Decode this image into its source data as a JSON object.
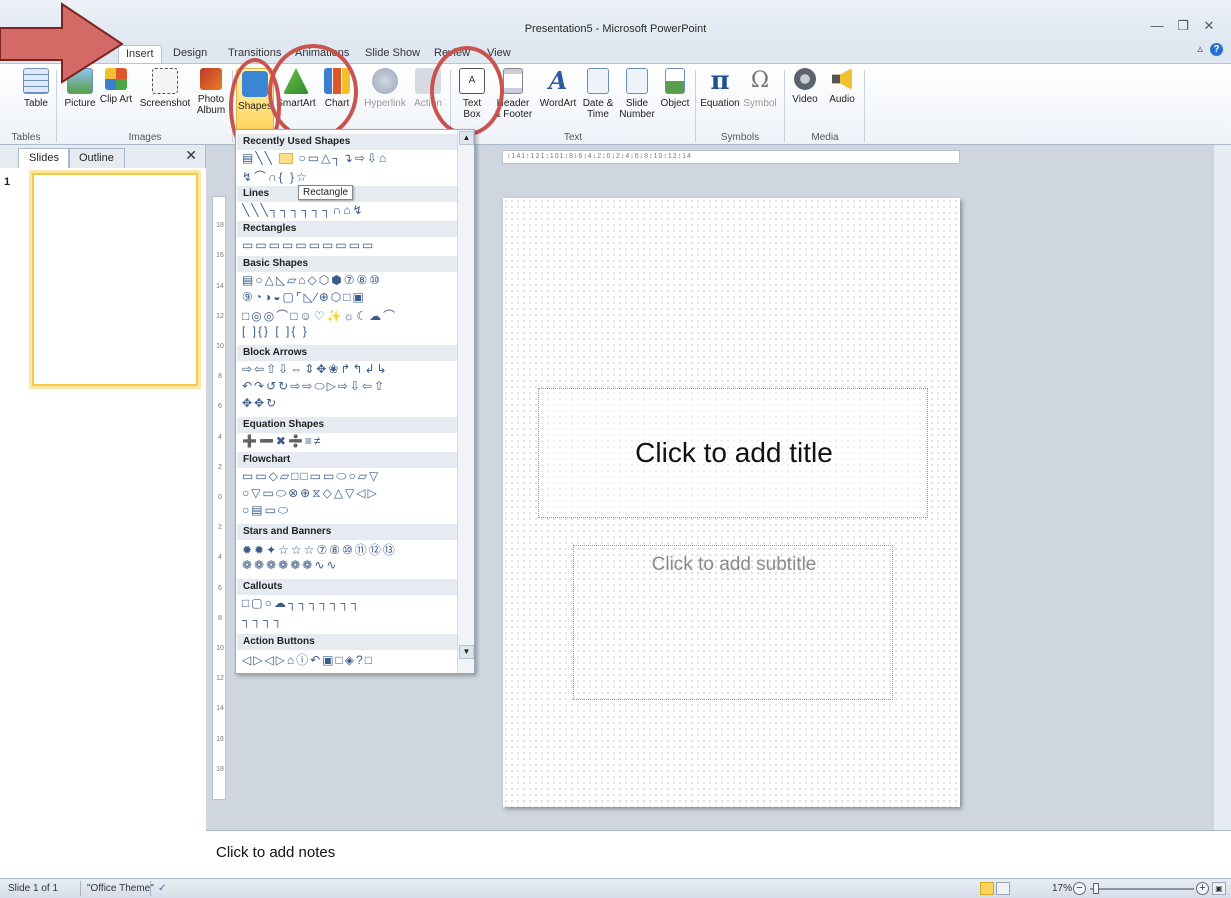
{
  "window": {
    "title": "Presentation5 - Microsoft PowerPoint",
    "qat_symbol": "↺ |▾",
    "minimize": "—",
    "restore": "❐",
    "close": "✕",
    "ribbon_collapse": "▵",
    "help": "?"
  },
  "tabs": [
    {
      "label": "Insert",
      "active": true
    },
    {
      "label": "Design"
    },
    {
      "label": "Transitions"
    },
    {
      "label": "Animations"
    },
    {
      "label": "Slide Show"
    },
    {
      "label": "Review"
    },
    {
      "label": "View"
    }
  ],
  "ribbon": {
    "buttons": {
      "table": "Table",
      "picture": "Picture",
      "clip_art": "Clip Art",
      "screenshot": "Screenshot",
      "photo_album": "Photo Album",
      "shapes": "Shapes",
      "smartart": "SmartArt",
      "chart": "Chart",
      "hyperlink": "Hyperlink",
      "action": "Action",
      "text_box": "Text Box",
      "header_footer": "Header & Footer",
      "wordart": "WordArt",
      "date_time": "Date & Time",
      "slide_number": "Slide Number",
      "object": "Object",
      "equation": "Equation",
      "symbol": "Symbol",
      "video": "Video",
      "audio": "Audio"
    },
    "groups": {
      "tables": "Tables",
      "images": "Images",
      "text": "Text",
      "symbols": "Symbols",
      "media": "Media"
    },
    "icons": {
      "table": "table-icon",
      "picture": "picture-icon",
      "clip_art": "clip-art-icon",
      "screenshot": "screenshot-icon",
      "photo_album": "photo-album-icon",
      "shapes": "shapes-icon",
      "smartart": "smartart-icon",
      "chart": "chart-icon",
      "hyperlink": "hyperlink-icon",
      "action": "action-icon",
      "text_box": "text-box-icon",
      "header_footer": "header-footer-icon",
      "wordart": "wordart-icon",
      "date_time": "date-time-icon",
      "slide_number": "slide-number-icon",
      "object": "object-icon",
      "equation": "equation-icon",
      "symbol": "symbol-icon",
      "video": "video-icon",
      "audio": "audio-icon"
    },
    "equation_glyph": "π",
    "symbol_glyph": "Ω",
    "wordart_glyph": "A"
  },
  "shapes_gallery": {
    "sections": {
      "recently_used": "Recently Used Shapes",
      "lines": "Lines",
      "rectangles": "Rectangles",
      "basic": "Basic Shapes",
      "block_arrows": "Block Arrows",
      "equation": "Equation Shapes",
      "flowchart": "Flowchart",
      "stars": "Stars and Banners",
      "callouts": "Callouts",
      "action_buttons": "Action Buttons"
    },
    "tooltip": "Rectangle",
    "rows": {
      "recent1_a": "▤╲╲",
      "recent1_b": "○▭△┐↴⇨⇩⌂",
      "recent2": "↯⌒∩{ }☆",
      "lines": "╲╲╲┐┐┐┐┐┐∩⌂↯",
      "rectangles": "▭▭▭▭▭▭▭▭▭▭",
      "basic1": "▤○△◺▱⌂◇⬡⬢⑦⑧⑩",
      "basic2": "⑨◔◑◒▢⌜◺∕⊕⬡□▣",
      "basic3": "□◎◎⌒□☺♡✨☼☾☁⌒",
      "basic4": "[ ]{} [ ]{ }",
      "arrows1": "⇨⇦⇧⇩⇔⇕✥❀↱↰↲↳",
      "arrows2": "↶↷↺↻⇨⇨⬭▷⇨⇩⇦⇧",
      "arrows3": "✥✥↻",
      "equation": "➕➖✖➗≡≠",
      "flow1": "▭▭◇▱□□▭▭⬭○▱▽",
      "flow2": "○▽▭⬭⊗⊕⧖◇△▽◁▷",
      "flow3": "○▤▭⬭",
      "stars1": "✹✹✦☆☆☆⑦⑧⑩⑪⑫⑬",
      "stars2": "❁❁❁❁❁❁∿∿",
      "callouts1": "□▢○☁┐┐┐┐┐┐┐",
      "callouts2": "┐┐┐┐",
      "action": "◁▷◁▷⌂ⓘ↶▣□◈?□"
    }
  },
  "slides_panel": {
    "tab_slides": "Slides",
    "tab_outline": "Outline",
    "close": "✕",
    "slide_number": "1"
  },
  "ruler": {
    "h_text": "↕141↕121↕101↕8↕6↕4↕2↕0↕2↕4↕6↕8↕10↕12↕14",
    "v_labels": [
      "18",
      "16",
      "14",
      "12",
      "10",
      "8",
      "6",
      "4",
      "2",
      "0",
      "2",
      "4",
      "6",
      "8",
      "10",
      "12",
      "14",
      "16",
      "18"
    ]
  },
  "slide": {
    "title_placeholder": "Click to add title",
    "subtitle_placeholder": "Click to add subtitle"
  },
  "notes": {
    "placeholder": "Click to add notes"
  },
  "statusbar": {
    "slide_count": "Slide 1 of 1",
    "theme": "\"Office Theme\"",
    "spell_check": "✓",
    "zoom": "17%",
    "zoom_minus": "−",
    "zoom_plus": "+",
    "fit_slide": "▣"
  },
  "colors": {
    "annotation": "#c9544f",
    "highlight": "#ffd45a",
    "ribbon_bg": "#eef2f8"
  }
}
